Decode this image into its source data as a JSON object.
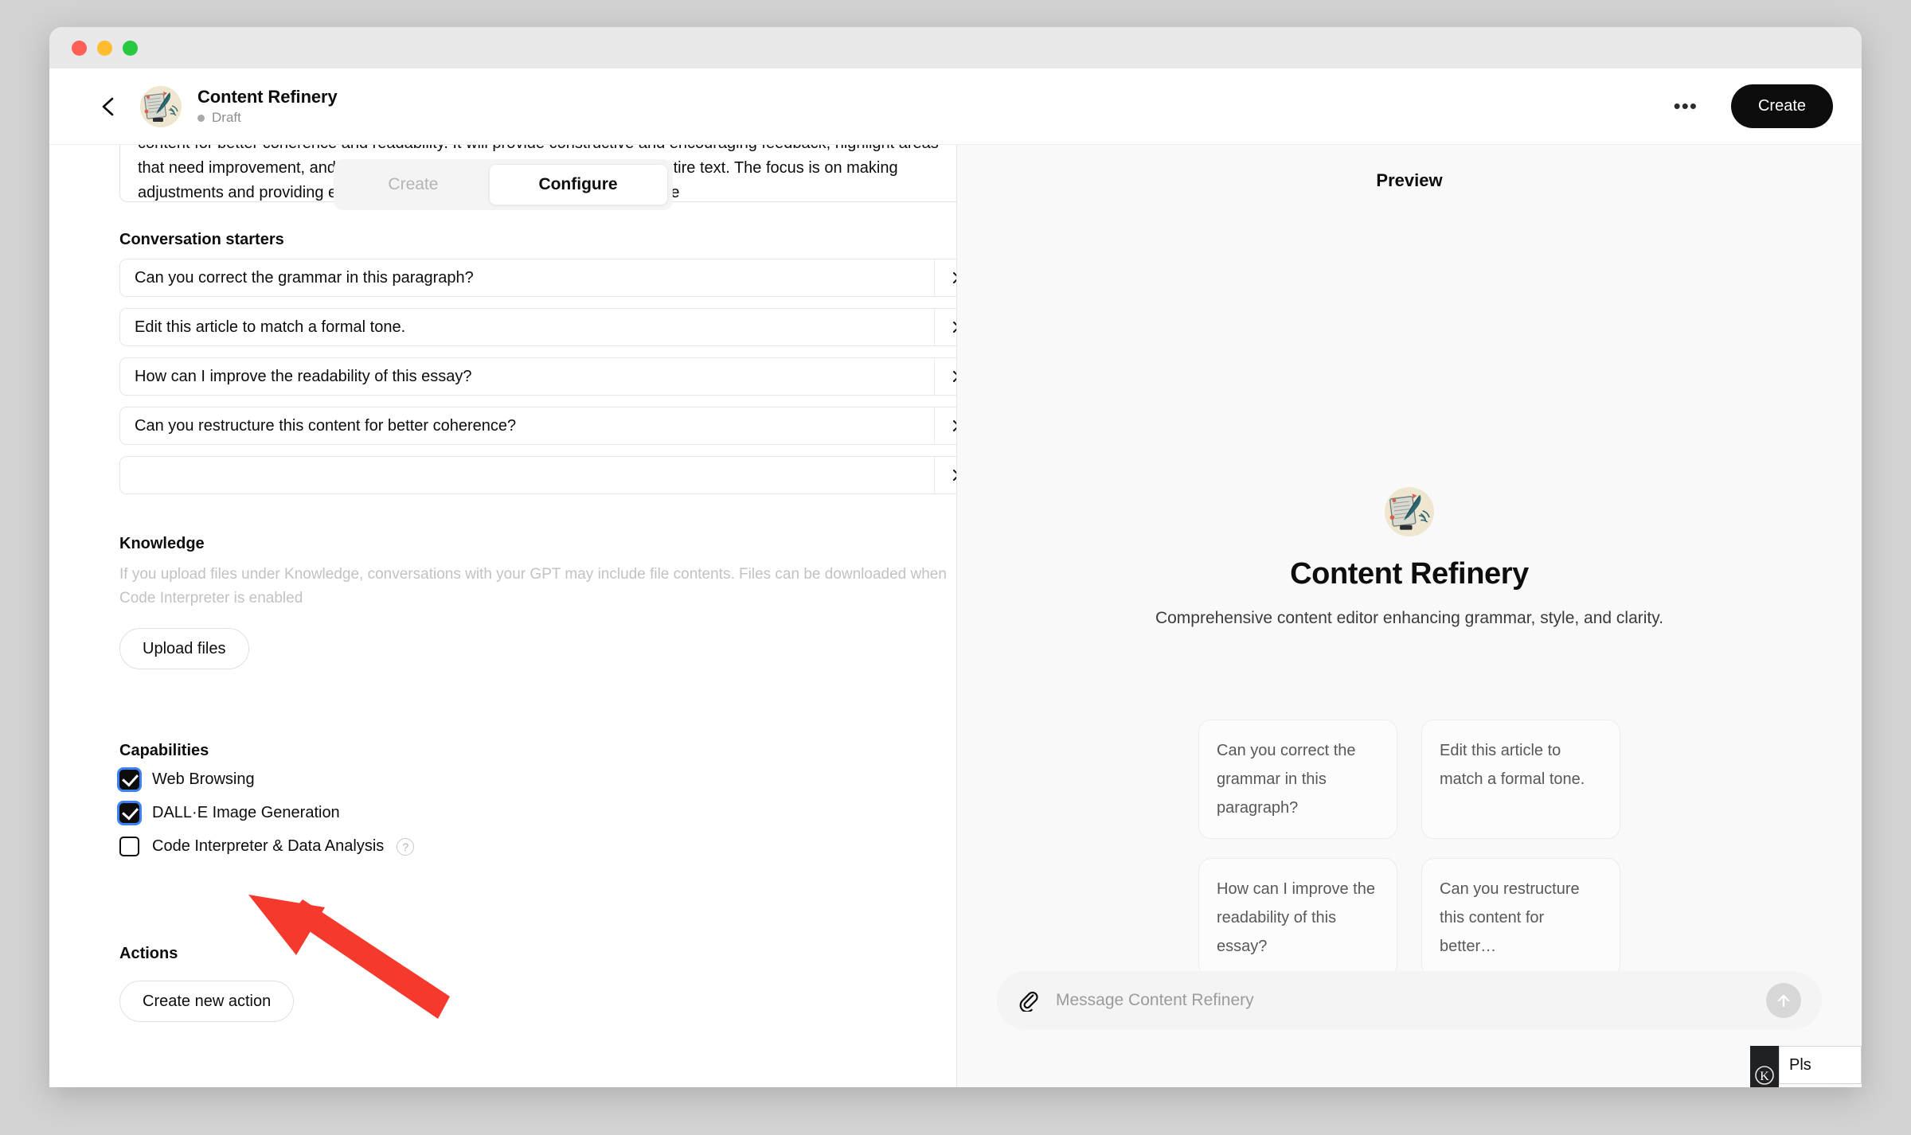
{
  "window": {
    "traffic_lights": [
      "close",
      "minimize",
      "maximize"
    ]
  },
  "header": {
    "back_icon": "chevron-left-icon",
    "gpt_name": "Content Refinery",
    "status": "Draft",
    "more_label": "•••",
    "create_label": "Create"
  },
  "tabs": [
    {
      "label": "Create",
      "active": false
    },
    {
      "label": "Configure",
      "active": true
    }
  ],
  "instructions": {
    "text": "content for better coherence and readability. It will provide constructive and encouraging feedback, highlight areas that need improvement, and suggest enhancements without rewriting the entire text. The focus is on making adjustments and providing explanations for suggested changes, ensuring the",
    "resize_icon": "resize-grip-icon"
  },
  "conversation_starters": {
    "label": "Conversation starters",
    "remove_icon": "close-icon",
    "items": [
      {
        "value": "Can you correct the grammar in this paragraph?",
        "placeholder": ""
      },
      {
        "value": "Edit this article to match a formal tone.",
        "placeholder": ""
      },
      {
        "value": "How can I improve the readability of this essay?",
        "placeholder": ""
      },
      {
        "value": "Can you restructure this content for better coherence?",
        "placeholder": ""
      },
      {
        "value": "",
        "placeholder": ""
      }
    ]
  },
  "knowledge": {
    "label": "Knowledge",
    "helper": "If you upload files under Knowledge, conversations with your GPT may include file contents. Files can be downloaded when Code Interpreter is enabled",
    "upload_label": "Upload files"
  },
  "capabilities": {
    "label": "Capabilities",
    "items": [
      {
        "label": "Web Browsing",
        "checked": true,
        "help": false
      },
      {
        "label": "DALL·E Image Generation",
        "checked": true,
        "help": false
      },
      {
        "label": "Code Interpreter & Data Analysis",
        "checked": false,
        "help": true,
        "help_glyph": "?"
      }
    ]
  },
  "actions": {
    "label": "Actions",
    "create_label": "Create new action"
  },
  "preview": {
    "title": "Preview",
    "gpt_name": "Content Refinery",
    "description": "Comprehensive content editor enhancing grammar, style, and clarity.",
    "suggestions": [
      "Can you correct the grammar in this paragraph?",
      "Edit this article to match a formal tone.",
      "How can I improve the readability of this essay?",
      "Can you restructure this content for better…"
    ],
    "composer": {
      "attach_icon": "paperclip-icon",
      "placeholder": "Message Content Refinery",
      "send_icon": "arrow-up-icon",
      "value": ""
    }
  },
  "annotation": {
    "arrow_color": "#F5392C",
    "points_at": "Upload files"
  },
  "corner_widget": {
    "logo_glyph": "Ⓚ",
    "text": "Pls"
  }
}
